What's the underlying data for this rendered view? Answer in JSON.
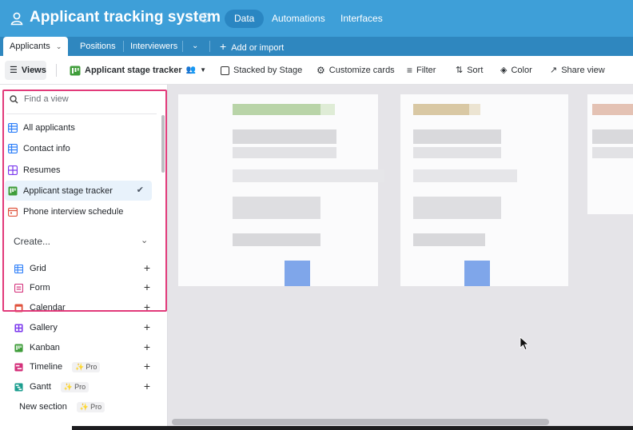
{
  "header": {
    "title": "Applicant tracking system",
    "nav": [
      "Data",
      "Automations",
      "Interfaces"
    ]
  },
  "tabs": {
    "items": [
      "Applicants",
      "Positions",
      "Interviewers"
    ],
    "add_label": "Add or import"
  },
  "toolbar": {
    "views_label": "Views",
    "current_view": "Applicant stage tracker",
    "stacked": "Stacked by Stage",
    "customize": "Customize cards",
    "filter": "Filter",
    "sort": "Sort",
    "color": "Color",
    "share": "Share view"
  },
  "sidebar": {
    "search_placeholder": "Find a view",
    "views": [
      {
        "label": "All applicants",
        "icon": "grid-icon"
      },
      {
        "label": "Contact info",
        "icon": "grid-icon"
      },
      {
        "label": "Resumes",
        "icon": "gallery-icon"
      },
      {
        "label": "Applicant stage tracker",
        "icon": "kanban-icon"
      },
      {
        "label": "Phone interview schedule",
        "icon": "calendar-icon"
      }
    ],
    "create_label": "Create...",
    "create_items": [
      {
        "label": "Grid",
        "icon": "grid-icon"
      },
      {
        "label": "Form",
        "icon": "form-icon"
      },
      {
        "label": "Calendar",
        "icon": "calendar-icon"
      },
      {
        "label": "Gallery",
        "icon": "gallery-icon"
      },
      {
        "label": "Kanban",
        "icon": "kanban-icon"
      },
      {
        "label": "Timeline",
        "icon": "timeline-icon",
        "badge": "Pro"
      },
      {
        "label": "Gantt",
        "icon": "gantt-icon",
        "badge": "Pro"
      },
      {
        "label": "New section",
        "badge": "Pro"
      }
    ]
  },
  "colors": {
    "header_bg": "#3e9fd8",
    "tabs_bg": "#2f87bf",
    "highlight": "#e23a7a",
    "selected_bg": "#e8f2fb"
  }
}
